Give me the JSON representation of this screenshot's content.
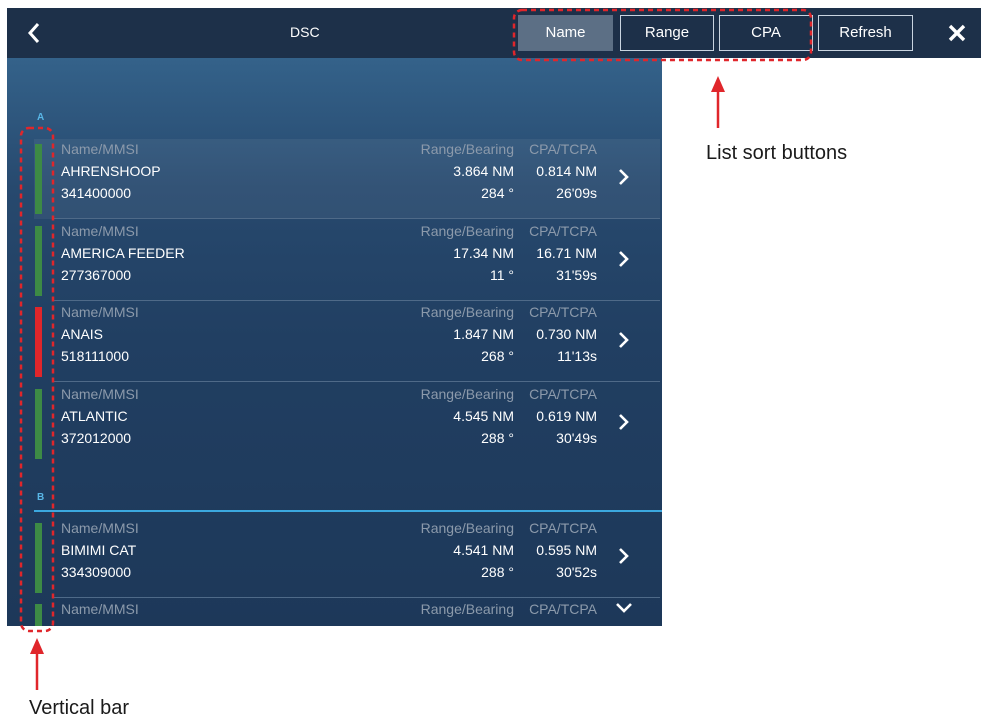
{
  "header": {
    "back_icon": "chevron-left-icon",
    "title": "DSC",
    "sort_buttons": [
      "Name",
      "Range",
      "CPA"
    ],
    "active_sort": "Name",
    "refresh_label": "Refresh",
    "close_icon": "close-icon"
  },
  "list": {
    "groups": [
      {
        "letter": "A"
      },
      {
        "letter": "B"
      }
    ],
    "col_labels": {
      "name": "Name/MMSI",
      "range": "Range/Bearing",
      "cpa": "CPA/TCPA"
    },
    "rows": [
      {
        "name": "AHRENSHOOP",
        "mmsi": "341400000",
        "range": "3.864 NM",
        "bearing": "284 °",
        "cpa": "0.814 NM",
        "tcpa": "26'09s",
        "status_color": "#3d8a45"
      },
      {
        "name": "AMERICA FEEDER",
        "mmsi": "277367000",
        "range": "17.34 NM",
        "bearing": "11 °",
        "cpa": "16.71 NM",
        "tcpa": "31'59s",
        "status_color": "#3d8a45"
      },
      {
        "name": "ANAIS",
        "mmsi": "518111000",
        "range": "1.847 NM",
        "bearing": "268 °",
        "cpa": "0.730 NM",
        "tcpa": "11'13s",
        "status_color": "#e0262b"
      },
      {
        "name": "ATLANTIC",
        "mmsi": "372012000",
        "range": "4.545 NM",
        "bearing": "288 °",
        "cpa": "0.619 NM",
        "tcpa": "30'49s",
        "status_color": "#3d8a45"
      },
      {
        "name": "BIMIMI CAT",
        "mmsi": "334309000",
        "range": "4.541 NM",
        "bearing": "288 °",
        "cpa": "0.595 NM",
        "tcpa": "30'52s",
        "status_color": "#3d8a45"
      },
      {
        "name": "",
        "mmsi": "",
        "range": "",
        "bearing": "",
        "cpa": "",
        "tcpa": "",
        "status_color": "#3d8a45"
      }
    ],
    "scroll_icon": "chevron-down-icon"
  },
  "annotations": {
    "sort_buttons_note": "List sort buttons",
    "vertical_bar_note": "Vertical bar",
    "highlight_color": "#e0262b"
  }
}
